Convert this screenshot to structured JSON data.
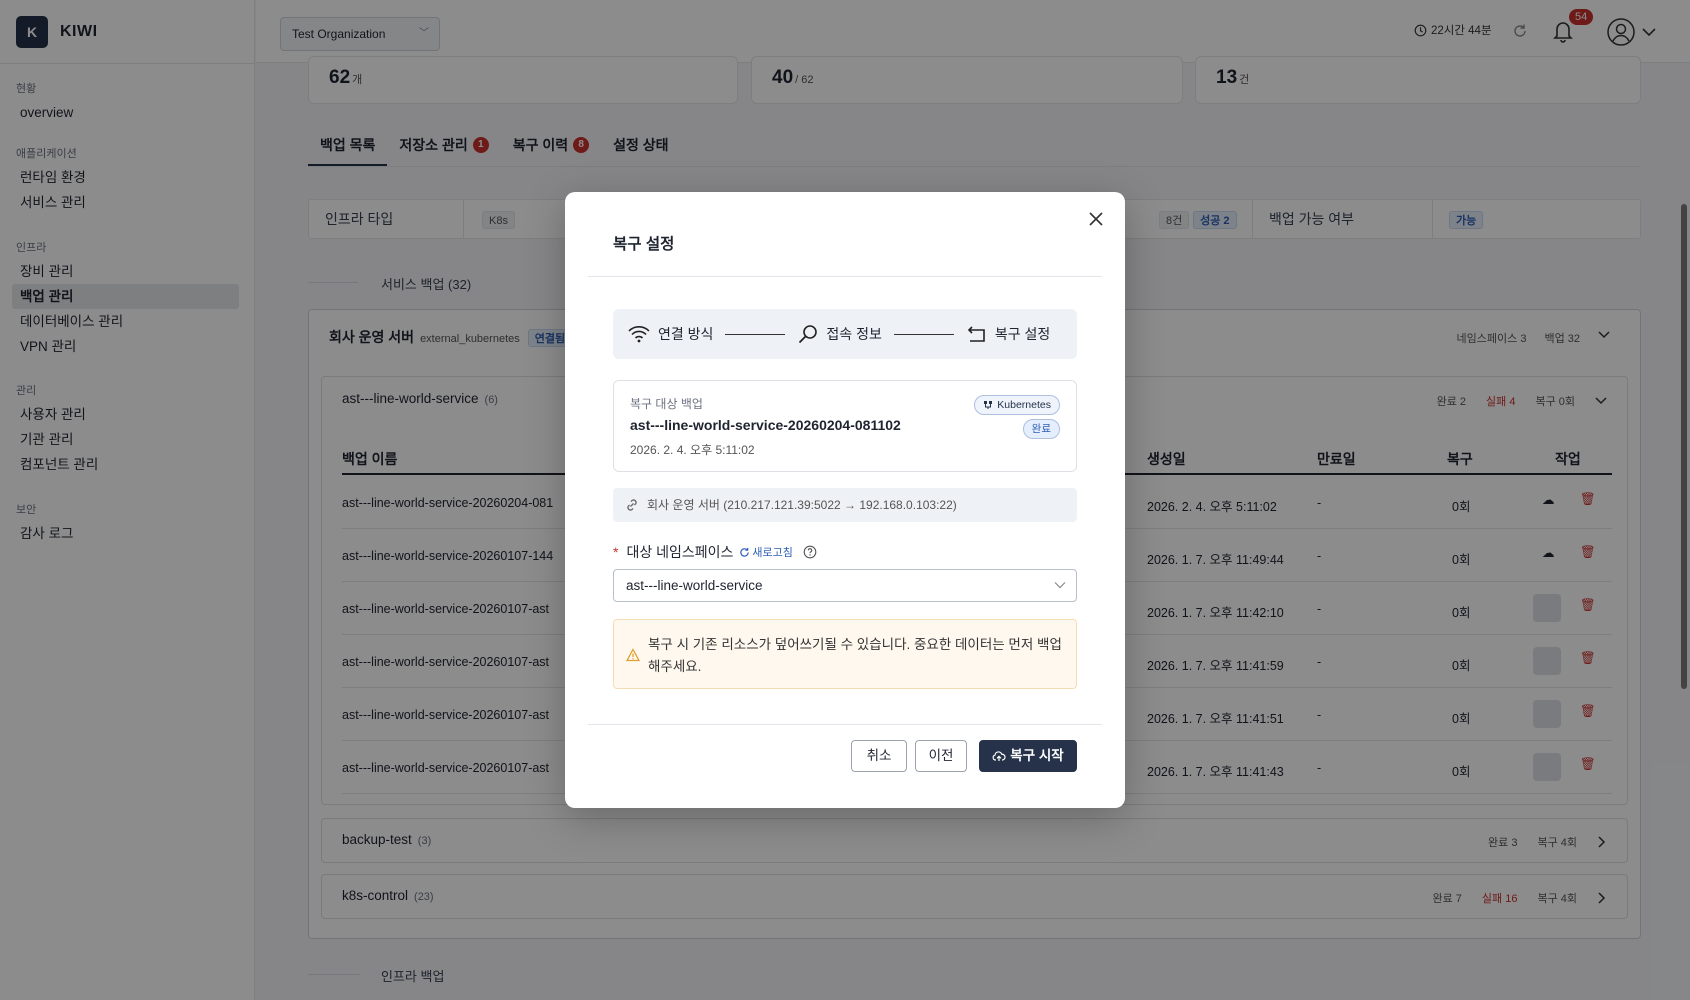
{
  "app": {
    "logo_letter": "K",
    "name": "KIWI"
  },
  "sidebar": {
    "sections": [
      {
        "title": "현황",
        "items": [
          {
            "label": "overview"
          }
        ]
      },
      {
        "title": "애플리케이션",
        "items": [
          {
            "label": "런타임 환경"
          },
          {
            "label": "서비스 관리"
          }
        ]
      },
      {
        "title": "인프라",
        "items": [
          {
            "label": "장비 관리"
          },
          {
            "label": "백업 관리"
          },
          {
            "label": "데이터베이스 관리"
          },
          {
            "label": "VPN 관리"
          }
        ]
      },
      {
        "title": "관리",
        "items": [
          {
            "label": "사용자 관리"
          },
          {
            "label": "기관 관리"
          },
          {
            "label": "컴포넌트 관리"
          }
        ]
      },
      {
        "title": "보안",
        "items": [
          {
            "label": "감사 로그"
          }
        ]
      }
    ],
    "active_item": "백업 관리"
  },
  "header": {
    "org": "Test Organization",
    "session": "22시간 44분",
    "notifications": "54"
  },
  "stats": [
    {
      "value": "62",
      "unit": "개"
    },
    {
      "value": "40",
      "unit": "/ 62"
    },
    {
      "value": "13",
      "unit": "건"
    }
  ],
  "tabs": [
    {
      "label": "백업 목록",
      "badge": ""
    },
    {
      "label": "저장소 관리",
      "badge": "1"
    },
    {
      "label": "복구 이력",
      "badge": "8"
    },
    {
      "label": "설정 상태",
      "badge": ""
    }
  ],
  "filter": {
    "infra_type_label": "인프라 타입",
    "infra_type_value": "K8s",
    "count_value": "8건",
    "success_value": "성공 2",
    "backup_possible_label": "백업 가능 여부",
    "backup_possible_value": "가능"
  },
  "sections": {
    "service_backup": "서비스 백업 (32)",
    "infra_backup": "인프라 백업"
  },
  "group": {
    "title": "회사 운영 서버",
    "type": "external_kubernetes",
    "status": "연결됨",
    "namespaces": "네임스페이스 3",
    "backups": "백업 32",
    "subgroups": [
      {
        "name": "ast---line-world-service",
        "count": "(6)",
        "done": "완료 2",
        "fail": "실패 4",
        "restore": "복구 0회"
      },
      {
        "name": "backup-test",
        "count": "(3)",
        "done": "완료 3",
        "fail": "",
        "restore": "복구 4회"
      },
      {
        "name": "k8s-control",
        "count": "(23)",
        "done": "완료 7",
        "fail": "실패 16",
        "restore": "복구 4회"
      }
    ]
  },
  "table": {
    "headers": {
      "name": "백업 이름",
      "created": "생성일",
      "expires": "만료일",
      "restore": "복구",
      "action": "작업"
    },
    "rows": [
      {
        "name": "ast---line-world-service-20260204-081",
        "created": "2026. 2. 4. 오후 5:11:02",
        "expires": "-",
        "restore": "0회"
      },
      {
        "name": "ast---line-world-service-20260107-144",
        "created": "2026. 1. 7. 오후 11:49:44",
        "expires": "-",
        "restore": "0회"
      },
      {
        "name": "ast---line-world-service-20260107-ast",
        "created": "2026. 1. 7. 오후 11:42:10",
        "expires": "-",
        "restore": "0회"
      },
      {
        "name": "ast---line-world-service-20260107-ast",
        "created": "2026. 1. 7. 오후 11:41:59",
        "expires": "-",
        "restore": "0회"
      },
      {
        "name": "ast---line-world-service-20260107-ast",
        "created": "2026. 1. 7. 오후 11:41:51",
        "expires": "-",
        "restore": "0회"
      },
      {
        "name": "ast---line-world-service-20260107-ast",
        "created": "2026. 1. 7. 오후 11:41:43",
        "expires": "-",
        "restore": "0회"
      }
    ]
  },
  "modal": {
    "title": "복구 설정",
    "steps": [
      {
        "label": "연결 방식"
      },
      {
        "label": "접속 정보"
      },
      {
        "label": "복구 설정"
      }
    ],
    "backup_card": {
      "label": "복구 대상 백업",
      "name": "ast---line-world-service-20260204-081102",
      "date": "2026. 2. 4. 오후 5:11:02",
      "type_badge": "Kubernetes",
      "status_badge": "완료"
    },
    "connection": "회사 운영 서버 (210.217.121.39:5022 → 192.168.0.103:22)",
    "namespace_label": "대상 네임스페이스",
    "refresh_label": "새로고침",
    "namespace_value": "ast---line-world-service",
    "warning": "복구 시 기존 리소스가 덮어쓰기될 수 있습니다. 중요한 데이터는 먼저 백업해주세요.",
    "buttons": {
      "cancel": "취소",
      "prev": "이전",
      "start": "복구 시작"
    }
  }
}
